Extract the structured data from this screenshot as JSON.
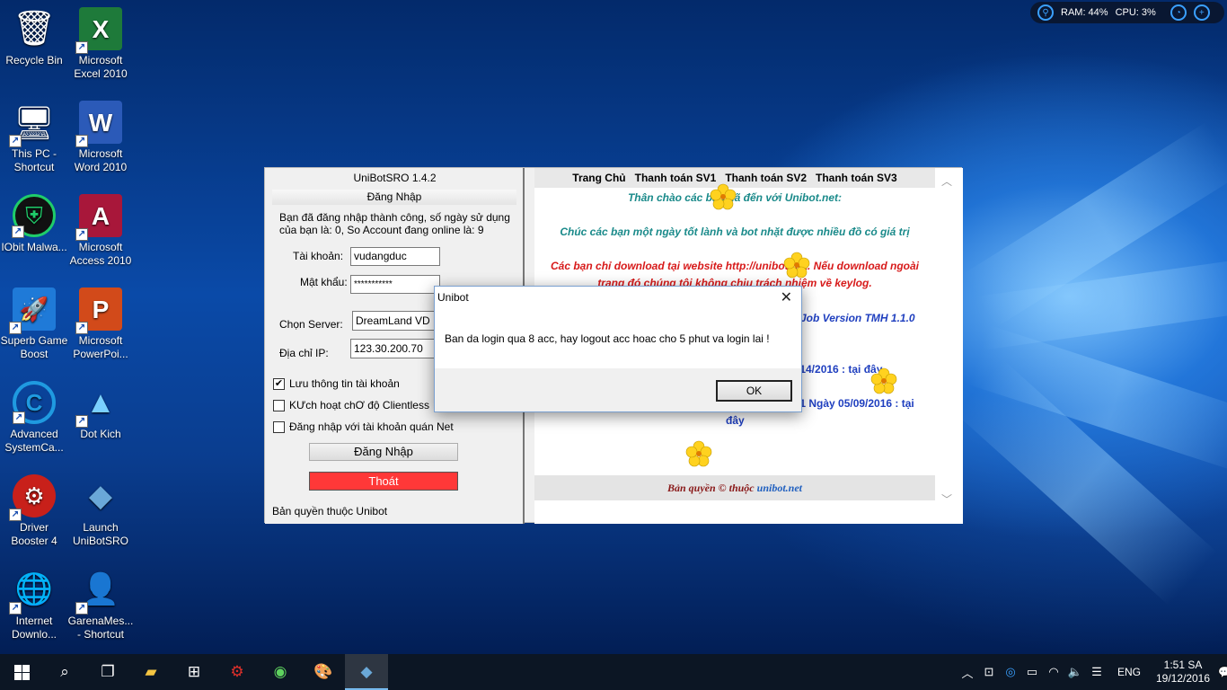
{
  "desktop": {
    "icons": [
      {
        "label": "Recycle Bin",
        "glyph": "🗑"
      },
      {
        "label": "Microsoft Excel 2010",
        "glyph": "X"
      },
      {
        "label": "This PC - Shortcut",
        "glyph": "🖥"
      },
      {
        "label": "Microsoft Word 2010",
        "glyph": "W"
      },
      {
        "label": "IObit Malwa...",
        "glyph": "⛨"
      },
      {
        "label": "Microsoft Access 2010",
        "glyph": "A"
      },
      {
        "label": "Superb Game Boost",
        "glyph": "🚀"
      },
      {
        "label": "Microsoft PowerPoi...",
        "glyph": "P"
      },
      {
        "label": "Advanced SystemCa...",
        "glyph": "C"
      },
      {
        "label": "Dot Kich",
        "glyph": "▲"
      },
      {
        "label": "Driver Booster 4",
        "glyph": "⚙"
      },
      {
        "label": "Launch UniBotSRO",
        "glyph": "◆"
      },
      {
        "label": "Internet Downlo...",
        "glyph": "🌐"
      },
      {
        "label": "GarenaMes... - Shortcut",
        "glyph": "👤"
      }
    ]
  },
  "tray_widget": {
    "ram": "RAM: 44%",
    "cpu": "CPU: 3%"
  },
  "app": {
    "title": "UniBotSRO 1.4.2",
    "section": "Đăng Nhập",
    "login_message": "Bạn đã đăng nhập thành công, số ngày sử dụng của bạn là: 0, So Account đang online là: 9",
    "username_label": "Tài khoản:",
    "username_value": "vudangduc",
    "password_label": "Mật khẩu:",
    "password_value": "***********",
    "server_label": "Chọn Server:",
    "server_value": "DreamLand VD",
    "ip_label": "Địa chỉ IP:",
    "ip_value": "123.30.200.70",
    "chk_save": "Lưu thông tin tài khoản",
    "chk_clientless": "KƯch hoạt chƠ độ Clientless",
    "chk_netcafe": "Đăng nhập với tài khoản quán Net",
    "login_button": "Đăng Nhập",
    "exit_button": "Thoát",
    "copyright": "Bản quyền thuộc Unibot"
  },
  "web": {
    "nav": [
      "Trang Chủ",
      "Thanh toán SV1",
      "Thanh toán SV2",
      "Thanh toán SV3"
    ],
    "welcome": "Thân chào các bạn đã đến với Unibot.net:",
    "wish": "Chúc các bạn một ngày tốt lành và bot nhặt được nhiều đồ có giá trị",
    "warning_1": "Các bạn chỉ download tại website http://unibot.net. Nếu download ngoài",
    "warning_2": "trang đó chúng tôi không chịu trách nhiệm về keylog.",
    "job_version": "Job Version TMH 1.1.0",
    "update_1": "/14/2016 : tại đây",
    "update_2": ".1 Ngày 05/09/2016 : tại",
    "update_3": "đây",
    "footer_text": "Bản quyền © thuộc ",
    "footer_link": "unibot.net"
  },
  "dialog": {
    "title": "Unibot",
    "message": "Ban da login qua 8 acc, hay logout acc hoac cho 5 phut va login lai !",
    "ok_button": "OK"
  },
  "taskbar": {
    "language": "ENG",
    "time": "1:51 SA",
    "date": "19/12/2016"
  },
  "colors": {
    "exit_button": "#ff3838",
    "teal_text": "#1a8a8a",
    "red_text": "#d71a1a",
    "blue_text": "#1f3fbf",
    "taskbar": "#0c1624"
  }
}
